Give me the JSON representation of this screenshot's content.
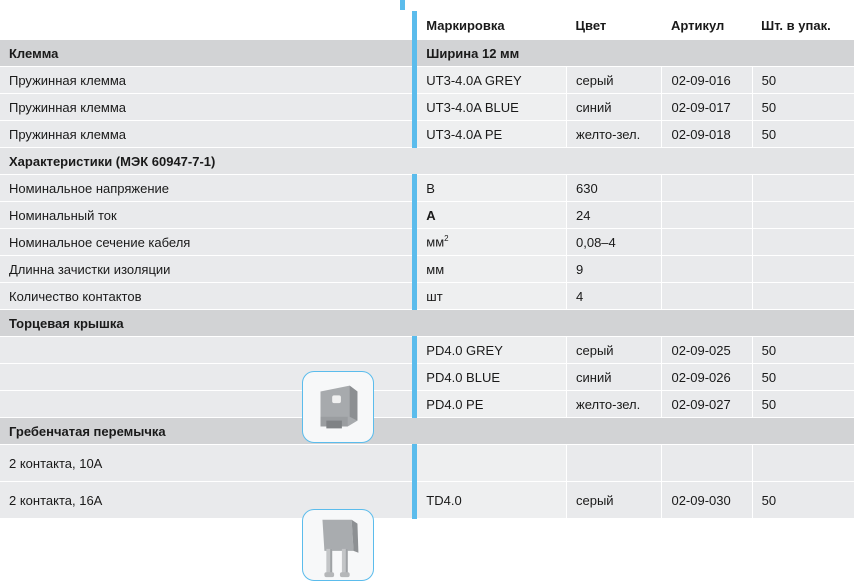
{
  "header": {
    "marking": "Маркировка",
    "color": "Цвет",
    "article": "Артикул",
    "qty": "Шт. в упак."
  },
  "section_terminal": {
    "title": "Клемма",
    "width": "Ширина 12 мм"
  },
  "terminals": [
    {
      "name": "Пружинная клемма",
      "marking": "UT3-4.0A GREY",
      "color": "серый",
      "article": "02-09-016",
      "qty": "50"
    },
    {
      "name": "Пружинная клемма",
      "marking": "UT3-4.0A BLUE",
      "color": "синий",
      "article": "02-09-017",
      "qty": "50"
    },
    {
      "name": "Пружинная клемма",
      "marking": "UT3-4.0A PE",
      "color": "желто-зел.",
      "article": "02-09-018",
      "qty": "50"
    }
  ],
  "characteristics_title": "Характеристики (МЭК 60947-7-1)",
  "characteristics": [
    {
      "name": "Номинальное напряжение",
      "unit": "В",
      "value": "630"
    },
    {
      "name": "Номинальный ток",
      "unit": "А",
      "value": "24"
    },
    {
      "name": "Номинальное сечение кабеля",
      "unit": "мм",
      "unit_sup": "2",
      "value": "0,08–4"
    },
    {
      "name": "Длинна зачистки изоляции",
      "unit": "мм",
      "value": "9"
    },
    {
      "name": "Количество контактов",
      "unit": "шт",
      "value": "4"
    }
  ],
  "end_cover_title": "Торцевая крышка",
  "end_covers": [
    {
      "marking": "PD4.0 GREY",
      "color": "серый",
      "article": "02-09-025",
      "qty": "50"
    },
    {
      "marking": "PD4.0 BLUE",
      "color": "синий",
      "article": "02-09-026",
      "qty": "50"
    },
    {
      "marking": "PD4.0 PE",
      "color": "желто-зел.",
      "article": "02-09-027",
      "qty": "50"
    }
  ],
  "jumper_title": "Гребенчатая перемычка",
  "jumpers": [
    {
      "name": "2 контакта, 10А",
      "marking": "",
      "color": "",
      "article": "",
      "qty": ""
    },
    {
      "name": "2 контакта, 16А",
      "marking": "TD4.0",
      "color": "серый",
      "article": "02-09-030",
      "qty": "50"
    }
  ],
  "colors": {
    "accent": "#5bbcec",
    "section_bg": "#d2d3d5",
    "row_bg": "#e9eaec"
  }
}
